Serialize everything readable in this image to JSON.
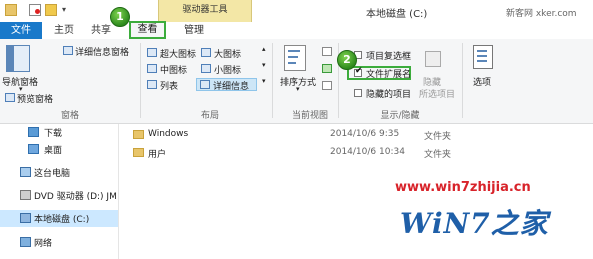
{
  "titlebar": {
    "context_tab_label": "驱动器工具",
    "window_title": "本地磁盘 (C:)",
    "watermark": "新客网 xker.com"
  },
  "tabs": {
    "file": "文件",
    "home": "主页",
    "share": "共享",
    "view": "查看",
    "manage": "管理"
  },
  "badges": {
    "first": "1",
    "second": "2"
  },
  "ribbon": {
    "panes": {
      "navigation_pane": "导航窗格",
      "preview_pane": "预览窗格",
      "details_pane": "详细信息窗格",
      "group_label": "窗格"
    },
    "layout": {
      "extra_large_icons": "超大图标",
      "large_icons": "大图标",
      "medium_icons": "中图标",
      "small_icons": "小图标",
      "list": "列表",
      "details": "详细信息",
      "group_label": "布局"
    },
    "current_view": {
      "sort_by": "排序方式",
      "group_label": "当前视图"
    },
    "show_hide": {
      "item_checkboxes": "项目复选框",
      "file_extensions": "文件扩展名",
      "hidden_items": "隐藏的项目",
      "hide_selected": "隐藏",
      "hide_selected_items": "所选项目",
      "group_label": "显示/隐藏",
      "item_checkboxes_checked": false,
      "file_extensions_checked": true,
      "hidden_items_checked": false
    },
    "options": {
      "label": "选项"
    }
  },
  "nav": {
    "downloads": "下载",
    "desktop": "桌面",
    "this_pc": "这台电脑",
    "dvd_drive": "DVD 驱动器 (D:) JM",
    "local_disk": "本地磁盘 (C:)",
    "network": "网络"
  },
  "files": [
    {
      "name": "Windows",
      "date": "2014/10/6 9:35",
      "type": "文件夹"
    },
    {
      "name": "用户",
      "date": "2014/10/6 10:34",
      "type": "文件夹"
    }
  ],
  "watermark": {
    "url": "www.win7zhijia.cn",
    "logo": "WiN7之家"
  },
  "colors": {
    "file_tab": "#1979ca",
    "highlight_green": "#3cac3c",
    "context_tab": "#f3e7a6",
    "selected_nav": "#cce8ff",
    "watermark_red": "#d8232a"
  }
}
